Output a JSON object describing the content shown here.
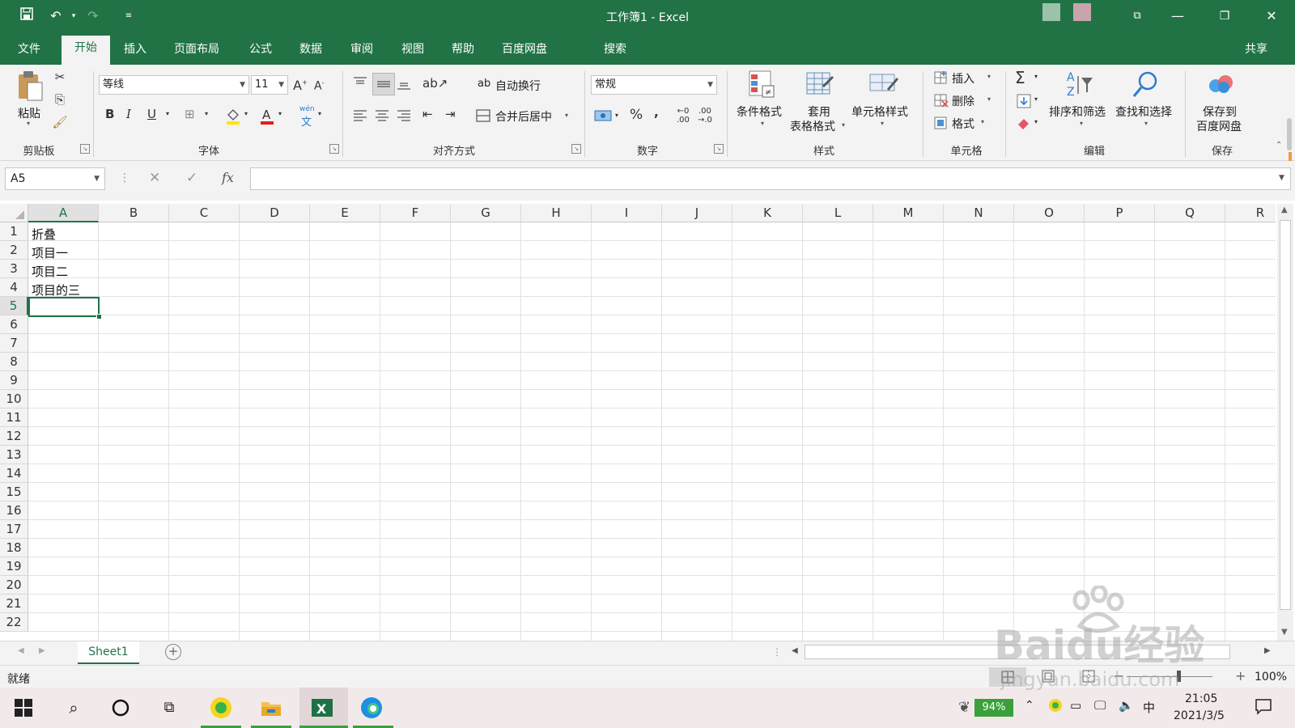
{
  "window": {
    "title": "工作簿1  -  Excel"
  },
  "menu": {
    "tabs": [
      "文件",
      "开始",
      "插入",
      "页面布局",
      "公式",
      "数据",
      "审阅",
      "视图",
      "帮助",
      "百度网盘"
    ],
    "search_label": "搜索",
    "share_label": "共享",
    "active_tab": "开始"
  },
  "ribbon": {
    "clipboard": {
      "paste": "粘贴",
      "group": "剪贴板"
    },
    "font": {
      "name": "等线",
      "size": "11",
      "group": "字体",
      "phonetic": "wén"
    },
    "alignment": {
      "wrap": "自动换行",
      "merge": "合并后居中",
      "group": "对齐方式"
    },
    "number": {
      "format": "常规",
      "percent": "%",
      "comma": ",",
      "group": "数字"
    },
    "styles": {
      "conditional": "条件格式",
      "table_line1": "套用",
      "table_line2": "表格格式",
      "cell_styles": "单元格样式",
      "group": "样式"
    },
    "cells": {
      "insert": "插入",
      "delete": "删除",
      "format": "格式",
      "group": "单元格"
    },
    "editing": {
      "sort_filter": "排序和筛选",
      "find_select": "查找和选择",
      "group": "编辑"
    },
    "save": {
      "line1": "保存到",
      "line2": "百度网盘",
      "group": "保存"
    }
  },
  "formula_bar": {
    "name_box": "A5",
    "fx": "fx",
    "content": ""
  },
  "grid": {
    "columns": [
      "A",
      "B",
      "C",
      "D",
      "E",
      "F",
      "G",
      "H",
      "I",
      "J",
      "K",
      "L",
      "M",
      "N",
      "O",
      "P",
      "Q",
      "R"
    ],
    "rows": [
      "1",
      "2",
      "3",
      "4",
      "5",
      "6",
      "7",
      "8",
      "9",
      "10",
      "11",
      "12",
      "13",
      "14",
      "15",
      "16",
      "17",
      "18",
      "19",
      "20",
      "21",
      "22"
    ],
    "cells": {
      "A1": "折叠",
      "A2": "项目一",
      "A3": "项目二",
      "A4": "项目的三"
    },
    "active_cell": "A5"
  },
  "sheets": {
    "tabs": [
      "Sheet1"
    ],
    "active": "Sheet1"
  },
  "status": {
    "ready": "就绪",
    "zoom": "100%"
  },
  "taskbar": {
    "battery": "94%",
    "ime": "中",
    "time": "21:05",
    "date": "2021/3/5"
  },
  "watermark": {
    "text": "Baidu经验",
    "url": "jingyan.baidu.com"
  },
  "colors": {
    "excel_green": "#217346",
    "ribbon_bg": "#f3f3f3"
  }
}
